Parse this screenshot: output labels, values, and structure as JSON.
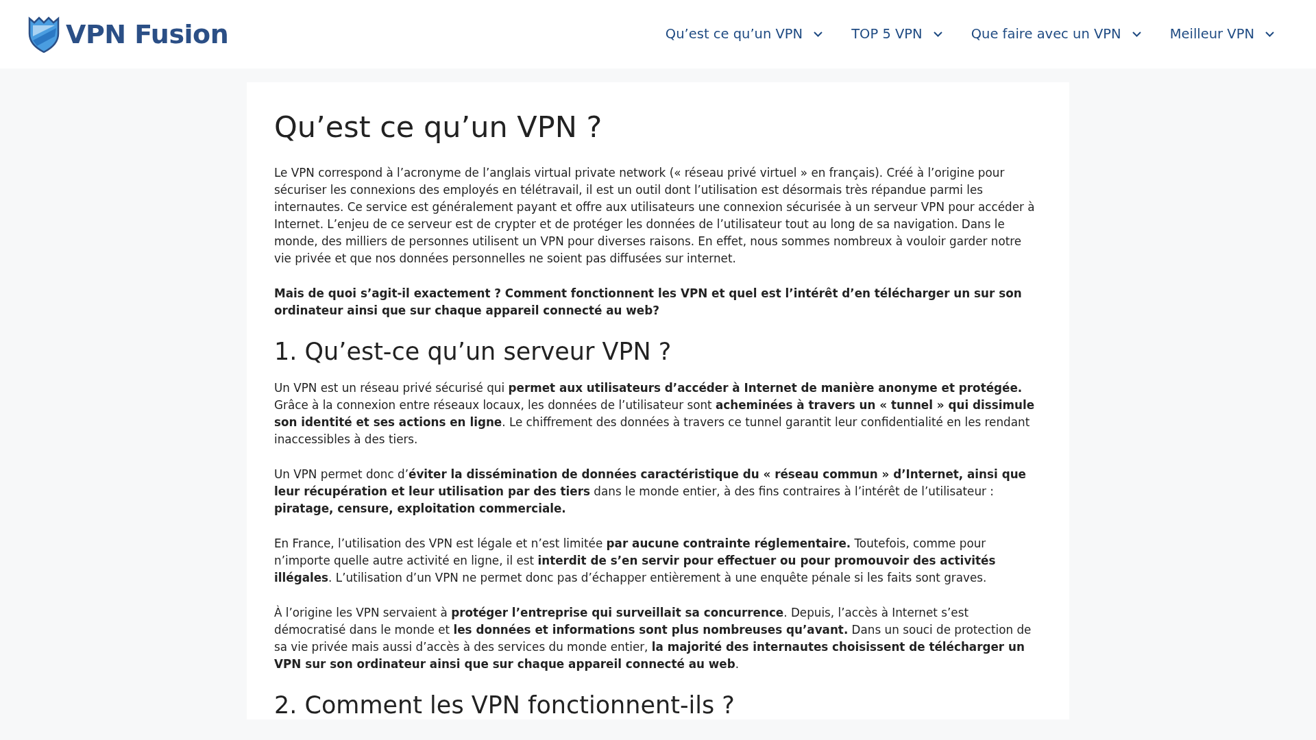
{
  "header": {
    "logo_text": "VPN Fusion",
    "nav": [
      {
        "label": "Qu’est ce qu’un VPN"
      },
      {
        "label": "TOP 5 VPN"
      },
      {
        "label": "Que faire avec un VPN"
      },
      {
        "label": "Meilleur VPN"
      }
    ]
  },
  "article": {
    "title": "Qu’est ce qu’un VPN ?",
    "blocks": [
      {
        "kind": "paragraph",
        "text": "Le VPN correspond à l’acronyme de l’anglais virtual private network (« réseau privé virtuel » en français). Créé à l’origine pour sécuriser les connexions des employés en télétravail, il est un outil dont l’utilisation est désormais très répandue parmi les internautes. Ce service est généralement payant et offre aux utilisateurs une connexion sécurisée à un serveur VPN pour accéder à Internet. L’enjeu de ce serveur est de crypter et de protéger les données de l’utilisateur tout au long de sa navigation. Dans le monde, des milliers de personnes utilisent un VPN pour diverses raisons. En effet, nous sommes nombreux à vouloir garder notre vie privée et que nos données personnelles ne soient pas diffusées sur internet."
      },
      {
        "kind": "bold-paragraph",
        "text": "Mais de quoi s’agit-il exactement ? Comment fonctionnent les VPN et quel est l’intérêt d’en télécharger un sur son ordinateur ainsi que sur chaque appareil connecté au web?"
      },
      {
        "kind": "heading",
        "text": "1. Qu’est-ce qu’un serveur VPN ?"
      },
      {
        "kind": "paragraph",
        "text": "Un VPN est un réseau privé sécurisé qui **permet aux utilisateurs d’accéder à Internet de manière anonyme et protégée.** Grâce à la connexion entre réseaux locaux, les données de l’utilisateur sont **acheminées à travers un « tunnel » qui dissimule son identité et ses actions en ligne**. Le chiffrement des données à travers ce tunnel garantit leur confidentialité en les rendant inaccessibles à des tiers."
      },
      {
        "kind": "paragraph",
        "text": "Un VPN permet donc d’**éviter la dissémination de données caractéristique du « réseau commun » d’Internet, ainsi que leur récupération et leur utilisation par des tiers** dans le monde entier, à des fins contraires à l’intérêt de l’utilisateur : **piratage, censure, exploitation commerciale.**"
      },
      {
        "kind": "paragraph",
        "text": "En France, l’utilisation des VPN est légale et n’est limitée **par aucune contrainte réglementaire.** Toutefois, comme pour n’importe quelle autre activité en ligne, il est **interdit de s’en servir pour effectuer ou pour promouvoir des activités illégales**. L’utilisation d’un VPN ne permet donc pas d’échapper entièrement à une enquête pénale si les faits sont graves."
      },
      {
        "kind": "paragraph",
        "text": "À l’origine les VPN servaient à **protéger l’entreprise qui surveillait sa concurrence**. Depuis, l’accès à Internet s’est démocratisé dans le monde et **les données et informations sont plus nombreuses qu’avant.** Dans un souci de protection de sa vie privée mais aussi d’accès à des services du monde entier, **la majorité des internautes choisissent de télécharger un VPN sur son ordinateur ainsi que sur chaque appareil connecté au web**."
      },
      {
        "kind": "heading",
        "text": "2. Comment les VPN fonctionnent-ils ?"
      }
    ]
  }
}
